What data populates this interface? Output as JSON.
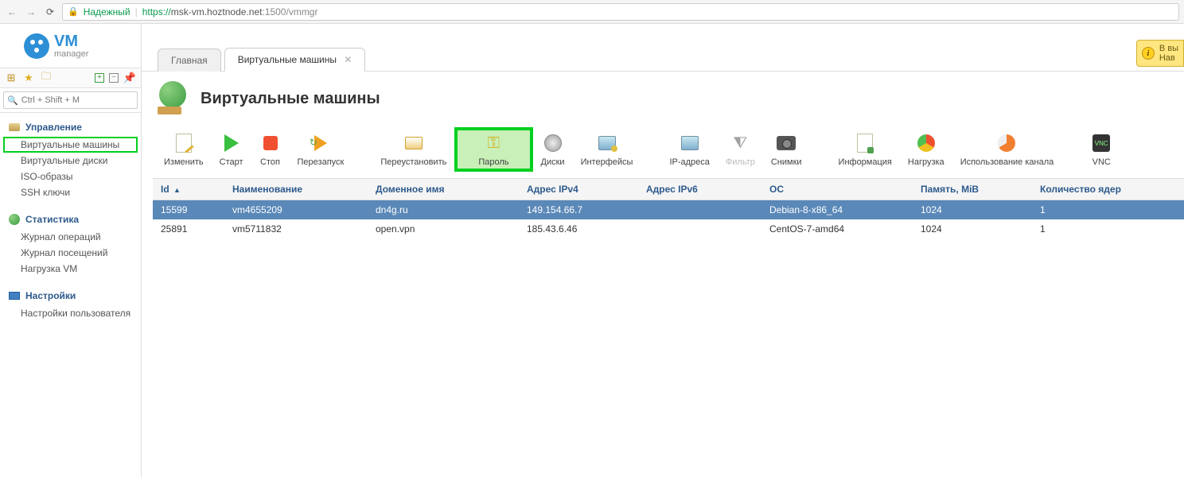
{
  "browser": {
    "secure_label": "Надежный",
    "url_https": "https://",
    "url_host": "msk-vm.hoztnode.net",
    "url_port": ":1500",
    "url_path": "/vmmgr"
  },
  "logo": {
    "vm": "VM",
    "mgr": "manager"
  },
  "search": {
    "placeholder": "Ctrl + Shift + M"
  },
  "nav": {
    "management": {
      "header": "Управление",
      "items": [
        "Виртуальные машины",
        "Виртуальные диски",
        "ISO-образы",
        "SSH ключи"
      ]
    },
    "statistics": {
      "header": "Статистика",
      "items": [
        "Журнал операций",
        "Журнал посещений",
        "Нагрузка VM"
      ]
    },
    "settings": {
      "header": "Настройки",
      "items": [
        "Настройки пользователя"
      ]
    }
  },
  "tabs": {
    "main": "Главная",
    "vms": "Виртуальные машины"
  },
  "help": {
    "line1": "В вы",
    "line2": "Нав"
  },
  "page": {
    "title": "Виртуальные машины"
  },
  "actions": {
    "edit": "Изменить",
    "start": "Старт",
    "stop": "Стоп",
    "restart": "Перезапуск",
    "reinstall": "Переустановить",
    "password": "Пароль",
    "disks": "Диски",
    "interfaces": "Интерфейсы",
    "ip": "IP-адреса",
    "filter": "Фильтр",
    "snapshots": "Снимки",
    "info": "Информация",
    "load": "Нагрузка",
    "channel": "Использование канала",
    "vnc": "VNC"
  },
  "table": {
    "headers": {
      "id": "Id",
      "name": "Наименование",
      "domain": "Доменное имя",
      "ipv4": "Адрес IPv4",
      "ipv6": "Адрес IPv6",
      "os": "ОС",
      "memory": "Память, MiB",
      "cores": "Количество ядер"
    },
    "rows": [
      {
        "id": "15599",
        "name": "vm4655209",
        "domain": "dn4g.ru",
        "ipv4": "149.154.66.7",
        "ipv6": "",
        "os": "Debian-8-x86_64",
        "memory": "1024",
        "cores": "1"
      },
      {
        "id": "25891",
        "name": "vm5711832",
        "domain": "open.vpn",
        "ipv4": "185.43.6.46",
        "ipv6": "",
        "os": "CentOS-7-amd64",
        "memory": "1024",
        "cores": "1"
      }
    ]
  }
}
